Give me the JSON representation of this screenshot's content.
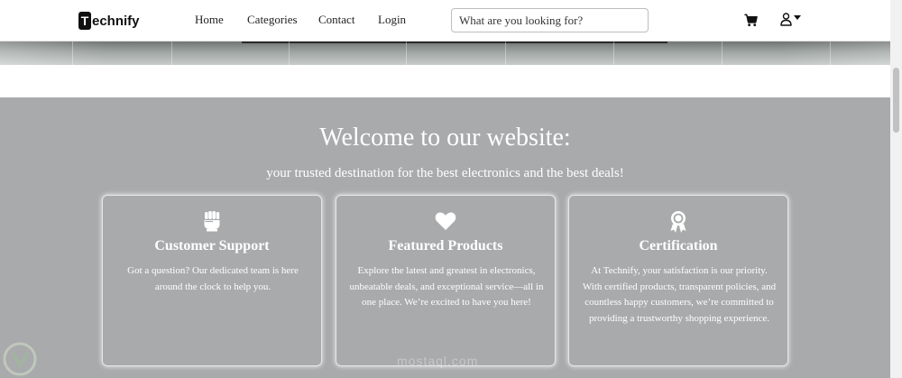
{
  "brand": {
    "badge": "T",
    "rest": "echnify"
  },
  "nav": {
    "home": "Home",
    "categories": "Categories",
    "contact": "Contact",
    "login": "Login"
  },
  "search": {
    "placeholder": "What are you looking for?"
  },
  "icons": {
    "cart": "cart-icon",
    "user": "user-icon",
    "caret": "caret-down-icon"
  },
  "welcome": {
    "title": "Welcome to our website:",
    "subtitle": "your trusted destination for the best electronics and the best deals!"
  },
  "cards": [
    {
      "icon": "fist-icon",
      "title": "Customer Support",
      "text": "Got a question? Our dedicated team is here around the clock to help you."
    },
    {
      "icon": "heart-icon",
      "title": "Featured Products",
      "text": "Explore the latest and greatest in electronics, unbeatable deals, and exceptional service—all in one place. We’re excited to have you here!"
    },
    {
      "icon": "award-icon",
      "title": "Certification",
      "text": "At Technify, your satisfaction is our priority. With certified products, transparent policies, and countless happy customers, we’re committed to providing a trustworthy shopping experience."
    }
  ],
  "watermark": {
    "text": "mostaql.com"
  },
  "colors": {
    "section_bg": "#a9aaab",
    "text_light": "#ffffff",
    "navbar_bg": "#ffffff"
  }
}
